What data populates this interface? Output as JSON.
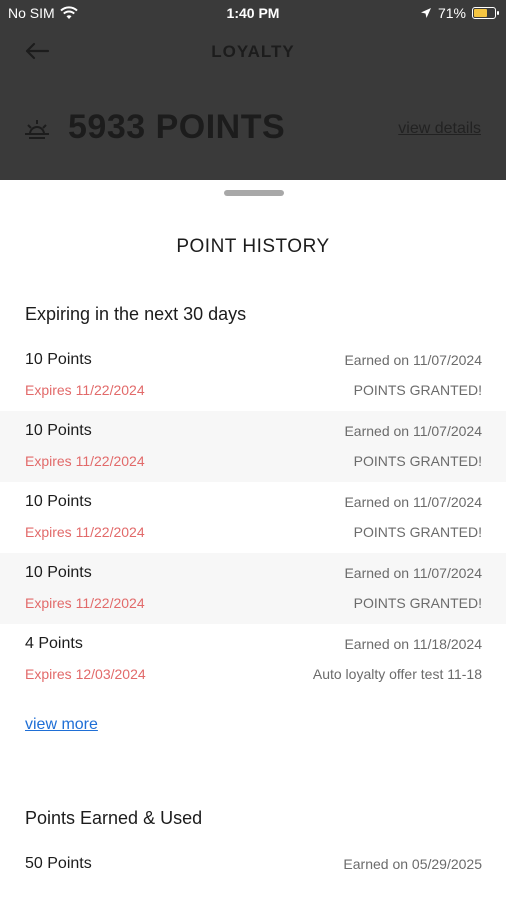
{
  "status_bar": {
    "carrier": "No SIM",
    "time": "1:40 PM",
    "battery_percent": "71%",
    "battery_level": 0.71,
    "icons": [
      "wifi-icon",
      "location-arrow-icon",
      "battery-charging-icon"
    ]
  },
  "header": {
    "title": "LOYALTY",
    "back_icon": "arrow-left-icon"
  },
  "points": {
    "value": "5933 POINTS",
    "icon": "sun-icon",
    "view_details": "view details"
  },
  "sheet": {
    "title": "POINT HISTORY",
    "expiring": {
      "title": "Expiring in the next 30 days",
      "items": [
        {
          "points": "10 Points",
          "expires": "Expires 11/22/2024",
          "earned": "Earned on 11/07/2024",
          "desc": "POINTS GRANTED!"
        },
        {
          "points": "10 Points",
          "expires": "Expires 11/22/2024",
          "earned": "Earned on 11/07/2024",
          "desc": "POINTS GRANTED!"
        },
        {
          "points": "10 Points",
          "expires": "Expires 11/22/2024",
          "earned": "Earned on 11/07/2024",
          "desc": "POINTS GRANTED!"
        },
        {
          "points": "10 Points",
          "expires": "Expires 11/22/2024",
          "earned": "Earned on 11/07/2024",
          "desc": "POINTS GRANTED!"
        },
        {
          "points": "4 Points",
          "expires": "Expires 12/03/2024",
          "earned": "Earned on 11/18/2024",
          "desc": "Auto loyalty offer test 11-18"
        }
      ],
      "view_more": "view more"
    },
    "earned_used": {
      "title": "Points Earned & Used",
      "items": [
        {
          "points": "50 Points",
          "earned": "Earned on 05/29/2025"
        }
      ]
    }
  },
  "colors": {
    "overlay": "#3a3a3a",
    "expires_red": "#e26a6a",
    "link_blue": "#1f6fd6",
    "alt_row": "#f7f7f7"
  }
}
